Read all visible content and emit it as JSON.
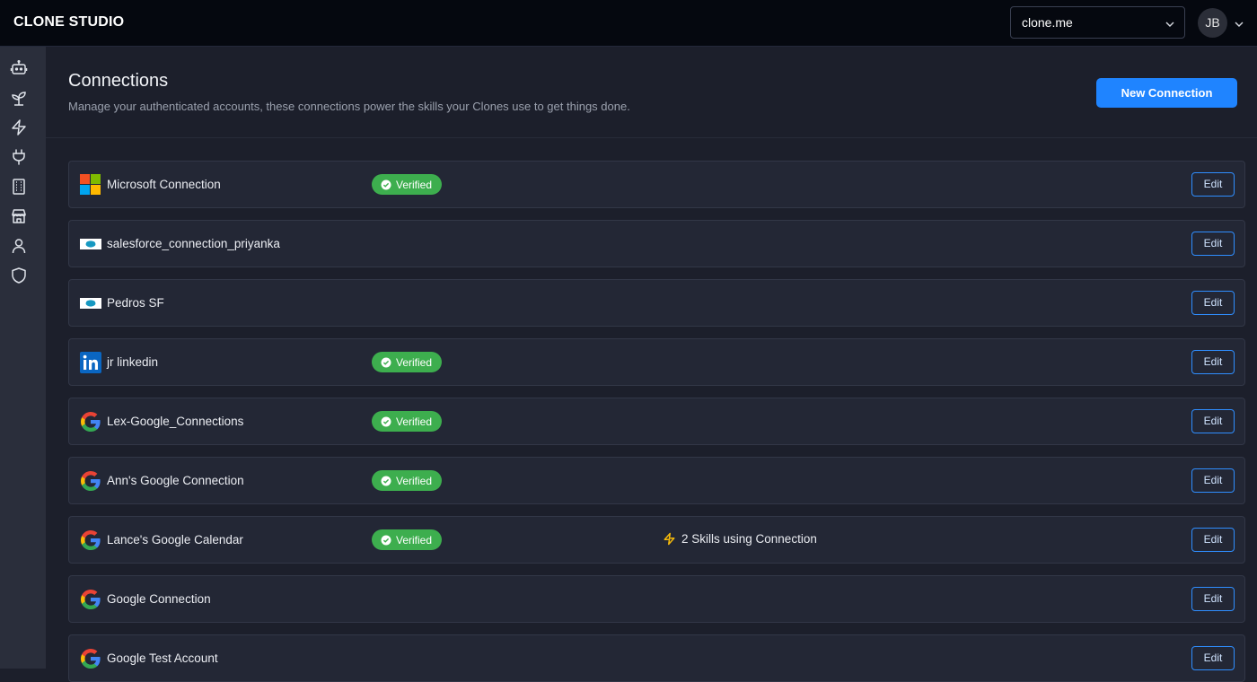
{
  "app": {
    "brand": "CLONE STUDIO"
  },
  "header": {
    "org_selector": {
      "value": "clone.me"
    },
    "avatar_initials": "JB"
  },
  "sidebar": {
    "items": [
      {
        "icon": "robot-icon"
      },
      {
        "icon": "sprout-icon"
      },
      {
        "icon": "lightning-icon"
      },
      {
        "icon": "plug-icon"
      },
      {
        "icon": "building-icon"
      },
      {
        "icon": "store-icon"
      },
      {
        "icon": "user-icon"
      },
      {
        "icon": "shield-icon"
      }
    ]
  },
  "page": {
    "title": "Connections",
    "subtitle": "Manage your authenticated accounts, these connections power the skills your Clones use to get things done.",
    "new_button": "New Connection"
  },
  "connections": [
    {
      "name": "Microsoft Connection",
      "provider": "microsoft",
      "verified": true,
      "status": "Verified",
      "skills": "",
      "edit": "Edit"
    },
    {
      "name": "salesforce_connection_priyanka",
      "provider": "salesforce",
      "verified": false,
      "status": "",
      "skills": "",
      "edit": "Edit"
    },
    {
      "name": "Pedros SF",
      "provider": "salesforce",
      "verified": false,
      "status": "",
      "skills": "",
      "edit": "Edit"
    },
    {
      "name": "jr linkedin",
      "provider": "linkedin",
      "verified": true,
      "status": "Verified",
      "skills": "",
      "edit": "Edit"
    },
    {
      "name": "Lex-Google_Connections",
      "provider": "google",
      "verified": true,
      "status": "Verified",
      "skills": "",
      "edit": "Edit"
    },
    {
      "name": "Ann's Google Connection",
      "provider": "google",
      "verified": true,
      "status": "Verified",
      "skills": "",
      "edit": "Edit"
    },
    {
      "name": "Lance's Google Calendar",
      "provider": "google",
      "verified": true,
      "status": "Verified",
      "skills": "2 Skills using Connection",
      "edit": "Edit"
    },
    {
      "name": "Google Connection",
      "provider": "google",
      "verified": false,
      "status": "",
      "skills": "",
      "edit": "Edit"
    },
    {
      "name": "Google Test Account",
      "provider": "google",
      "verified": false,
      "status": "",
      "skills": "",
      "edit": "Edit"
    }
  ],
  "colors": {
    "accent": "#1f84ff",
    "verified": "#3dae4e",
    "skills_bolt": "#f5b90a"
  }
}
